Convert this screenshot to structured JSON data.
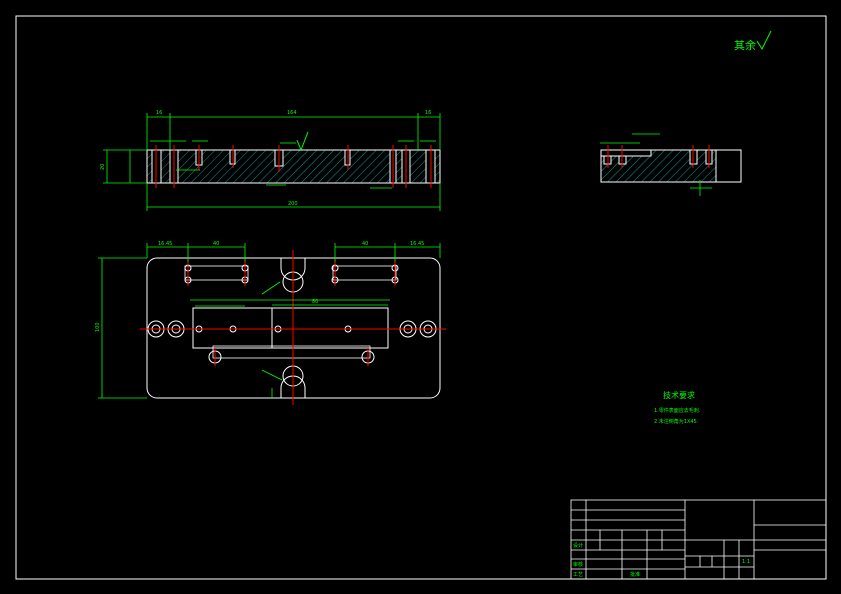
{
  "colors": {
    "background": "#000000",
    "outline": "#ffffff",
    "dimension": "#00ff00",
    "centerline": "#ff0000",
    "hatch": "#009a9a"
  },
  "surface_note": "其余",
  "tech_title": "技术要求",
  "tech_notes": [
    "1.零件表面应去毛刺.",
    "2.未注倒角为1X45."
  ],
  "front_dims": {
    "left_end": "16",
    "middle": "164",
    "right_end": "16",
    "total_length": "200",
    "height": "20"
  },
  "plan_dims": {
    "left_offset": "16.45",
    "left_pitch": "40",
    "right_pitch": "40",
    "right_offset": "16.45",
    "height": "100",
    "inner_length": "80"
  },
  "title_block": {
    "designer": "设计",
    "checker": "审核",
    "process": "工艺",
    "approve": "批准",
    "scale": "1:1"
  }
}
